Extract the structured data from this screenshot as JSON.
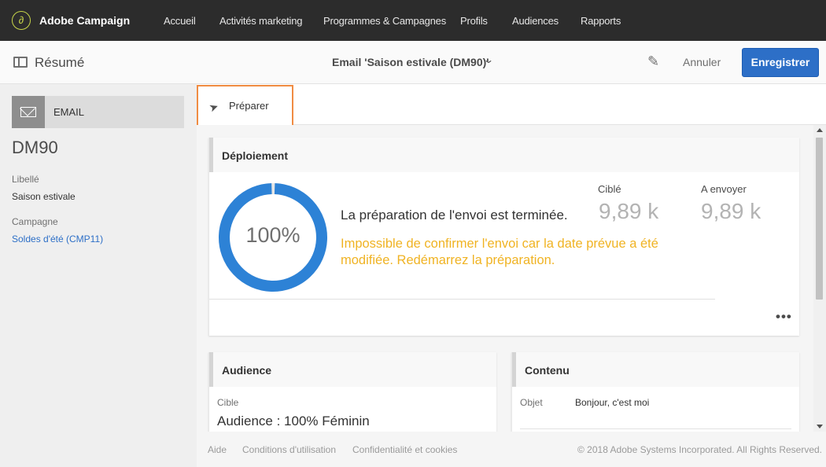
{
  "app": {
    "title": "Adobe Campaign",
    "logo_glyph": "∂"
  },
  "nav": {
    "items": [
      {
        "label": "Accueil"
      },
      {
        "label": "Activités marketing"
      },
      {
        "label": "Programmes & Campagnes"
      },
      {
        "label": "Profils"
      },
      {
        "label": "Audiences"
      },
      {
        "label": "Rapports"
      }
    ]
  },
  "header": {
    "section_label": "Résumé",
    "delivery_title": "Email 'Saison estivale (DM90)'",
    "cancel_label": "Annuler",
    "save_label": "Enregistrer"
  },
  "sidebar": {
    "type_label": "EMAIL",
    "code": "DM90",
    "label_caption": "Libellé",
    "label_value": "Saison estivale",
    "campaign_caption": "Campagne",
    "campaign_value": "Soldes d'été (CMP11)"
  },
  "actions": {
    "prepare_label": "Préparer"
  },
  "deployment": {
    "title": "Déploiement",
    "progress_percent": 100,
    "progress_text": "100%",
    "status": "La préparation de l'envoi est terminée.",
    "warning": "Impossible de confirmer l'envoi car la date prévue a été modifiée. Redémarrez la préparation.",
    "targeted_label": "Ciblé",
    "targeted_value": "9,89 k",
    "to_send_label": "A envoyer",
    "to_send_value": "9,89 k",
    "more_label": "•••"
  },
  "audience": {
    "title": "Audience",
    "target_caption": "Cible",
    "target_value": "Audience : 100% Féminin"
  },
  "content_card": {
    "title": "Contenu",
    "subject_caption": "Objet",
    "subject_value": "Bonjour, c'est moi"
  },
  "footer": {
    "help": "Aide",
    "terms": "Conditions d'utilisation",
    "privacy": "Confidentialité et cookies",
    "copyright": "© 2018 Adobe Systems Incorporated. All Rights Reserved."
  },
  "colors": {
    "accent": "#2d6fc7",
    "progress_ring": "#2d82d6",
    "warning": "#f0b323",
    "highlight_border": "#f08c43",
    "topbar": "#2c2c2c"
  }
}
